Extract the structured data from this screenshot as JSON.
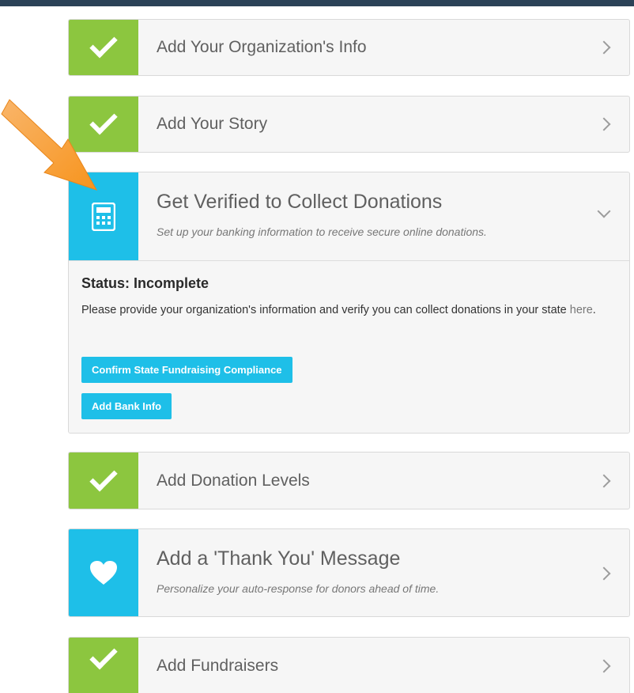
{
  "steps": [
    {
      "title": "Add Your Organization's Info",
      "icon": "check-icon",
      "color": "#8cc63f"
    },
    {
      "title": "Add Your Story",
      "icon": "check-icon",
      "color": "#8cc63f"
    },
    {
      "title": "Get Verified to Collect Donations",
      "subtitle": "Set up your banking information to receive secure online donations.",
      "icon": "calculator-icon",
      "color": "#1ebfe8",
      "status": "Status: Incomplete",
      "description": "Please provide your organization's information and verify you can collect donations in your state ",
      "description_link": "here",
      "description_end": ".",
      "buttons": [
        "Confirm State Fundraising Compliance",
        "Add Bank Info"
      ]
    },
    {
      "title": "Add Donation Levels",
      "icon": "check-icon",
      "color": "#8cc63f"
    },
    {
      "title": "Add a 'Thank You' Message",
      "subtitle": "Personalize your auto-response for donors ahead of time.",
      "icon": "heart-icon",
      "color": "#1ebfe8"
    },
    {
      "title": "Add Fundraisers",
      "icon": "check-icon",
      "color": "#8cc63f"
    }
  ],
  "accent_colors": {
    "complete": "#8cc63f",
    "pending": "#1ebfe8",
    "arrow": "#f7941d",
    "topbar": "#2b4257"
  }
}
